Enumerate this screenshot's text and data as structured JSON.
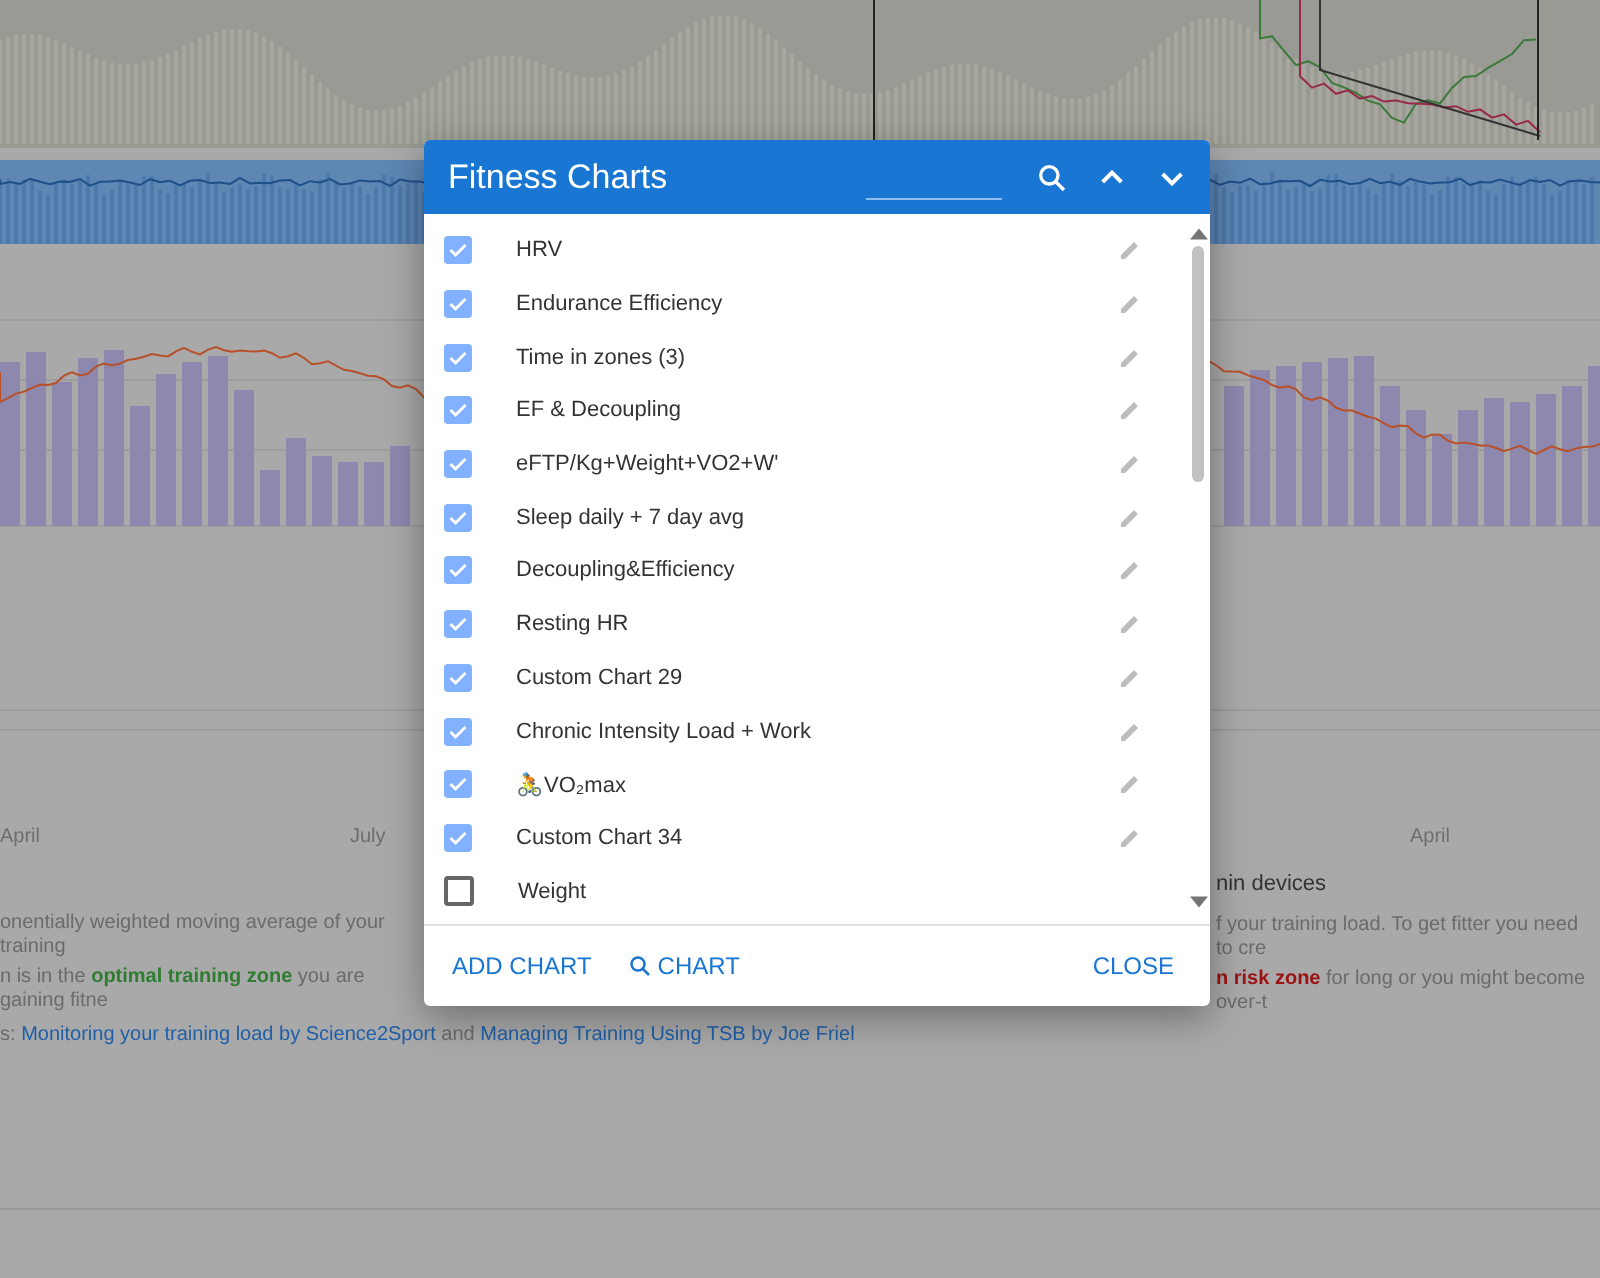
{
  "background": {
    "axis_labels": [
      "April",
      "July",
      "April"
    ],
    "legend_fragment": "nin devices",
    "left_lines": [
      "onentially weighted moving average of your training",
      "n is in the **optimal training zone** you are gaining fitne"
    ],
    "right_lines": [
      "f your training load. To get fitter you need to cre",
      "**n risk zone** for long or you might become over-t"
    ],
    "links_line": {
      "prefix": "s: ",
      "links": [
        "Monitoring your training load by Science2Sport",
        "Managing Training Using TSB by Joe Friel"
      ],
      "joiner": " and "
    }
  },
  "dialog": {
    "title": "Fitness Charts",
    "items": [
      {
        "label": "HRV",
        "checked": true
      },
      {
        "label": "Endurance Efficiency",
        "checked": true
      },
      {
        "label": "Time in zones (3)",
        "checked": true
      },
      {
        "label": "EF & Decoupling",
        "checked": true
      },
      {
        "label": "eFTP/Kg+Weight+VO2+W'",
        "checked": true
      },
      {
        "label": "Sleep daily + 7 day avg",
        "checked": true
      },
      {
        "label": "Decoupling&Efficiency",
        "checked": true
      },
      {
        "label": "Resting HR",
        "checked": true
      },
      {
        "label": "Custom Chart 29",
        "checked": true
      },
      {
        "label": "Chronic Intensity Load + Work",
        "checked": true
      },
      {
        "label": "🚴VO₂max",
        "checked": true
      },
      {
        "label": "Custom Chart 34",
        "checked": true
      },
      {
        "label": "Weight",
        "checked": false
      }
    ],
    "buttons": [
      {
        "label": "ADD CHART",
        "kind": "plain"
      },
      {
        "label": "CHART",
        "kind": "search"
      },
      {
        "label": "CLOSE",
        "kind": "close"
      }
    ]
  }
}
